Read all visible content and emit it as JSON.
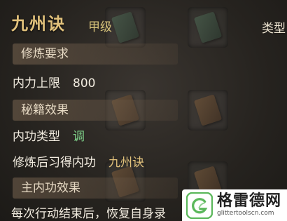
{
  "header": {
    "title": "九州诀",
    "grade": "甲级",
    "type_label": "类型"
  },
  "sections": {
    "requirements": "修炼要求",
    "effects": "秘籍效果",
    "main_effect": "主内功效果"
  },
  "rows": {
    "limit_label": "内力上限",
    "limit_value": "800",
    "type_label": "内功类型",
    "type_value": "调",
    "learn_label": "修炼后习得内功",
    "learn_value": "九州诀"
  },
  "footer": {
    "text": "每次行动结束后，恢复自身录"
  },
  "watermark": {
    "name": "格雷德网",
    "url": "glittertoolscn.com",
    "logo_icon": "g-leaf-logo-icon"
  },
  "colors": {
    "title": "#e2c27c",
    "type_value": "#7fd18a",
    "learn_value": "#e2c27c"
  }
}
